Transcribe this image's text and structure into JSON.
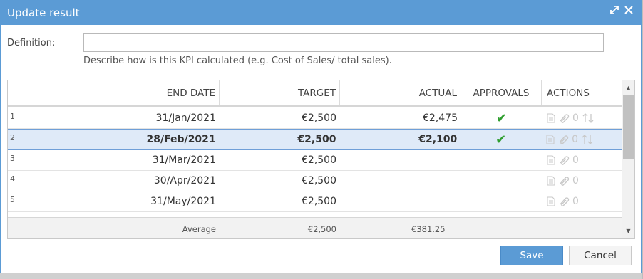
{
  "window": {
    "title": "Update result"
  },
  "definition": {
    "label": "Definition:",
    "value": "",
    "placeholder": "",
    "hint": "Describe how is this KPI calculated (e.g. Cost of Sales/ total sales)."
  },
  "grid": {
    "headers": {
      "end_date": "END DATE",
      "target": "TARGET",
      "actual": "ACTUAL",
      "approvals": "APPROVALS",
      "actions": "ACTIONS"
    },
    "rows": [
      {
        "num": "1",
        "end_date": "31/Jan/2021",
        "target": "€2,500",
        "actual": "€2,475",
        "approved": "✔",
        "attachments": "0"
      },
      {
        "num": "2",
        "end_date": "28/Feb/2021",
        "target": "€2,500",
        "actual": "€2,100",
        "approved": "✔",
        "attachments": "0"
      },
      {
        "num": "3",
        "end_date": "31/Mar/2021",
        "target": "€2,500",
        "actual": "",
        "approved": "",
        "attachments": "0"
      },
      {
        "num": "4",
        "end_date": "30/Apr/2021",
        "target": "€2,500",
        "actual": "",
        "approved": "",
        "attachments": "0"
      },
      {
        "num": "5",
        "end_date": "31/May/2021",
        "target": "€2,500",
        "actual": "",
        "approved": "",
        "attachments": "0"
      }
    ],
    "footer": {
      "label": "Average",
      "target": "€2,500",
      "actual": "€381.25"
    }
  },
  "buttons": {
    "save": "Save",
    "cancel": "Cancel"
  },
  "icons": {
    "maximize": "expand-icon",
    "close": "close-icon",
    "document": "document-icon",
    "attachment": "paperclip-icon",
    "reorder": "sort-arrows-icon",
    "approved": "checkmark-icon"
  },
  "colors": {
    "accent": "#5b9bd5",
    "selected_row": "#dfeaf8",
    "approved": "#2f9e2f"
  }
}
